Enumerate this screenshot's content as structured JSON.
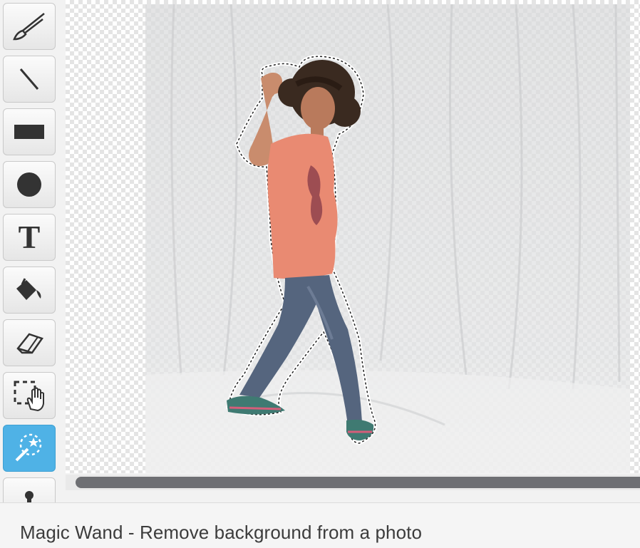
{
  "tools": [
    {
      "name": "brush",
      "icon": "brush-icon"
    },
    {
      "name": "line",
      "icon": "line-icon"
    },
    {
      "name": "rectangle",
      "icon": "rectangle-icon"
    },
    {
      "name": "ellipse",
      "icon": "circle-icon"
    },
    {
      "name": "text",
      "icon": "text-icon",
      "glyph": "T"
    },
    {
      "name": "fill",
      "icon": "paint-bucket-icon"
    },
    {
      "name": "eraser",
      "icon": "eraser-icon"
    },
    {
      "name": "select",
      "icon": "select-hand-icon"
    },
    {
      "name": "magic-wand",
      "icon": "magic-wand-icon",
      "selected": true
    },
    {
      "name": "stamp",
      "icon": "stamp-icon"
    }
  ],
  "colors": {
    "selected_tool": "#4fb2e6",
    "scroll_thumb": "#6e6f73",
    "shirt": "#e98a72",
    "jeans": "#55657e"
  },
  "caption": "Magic Wand - Remove background from a photo"
}
